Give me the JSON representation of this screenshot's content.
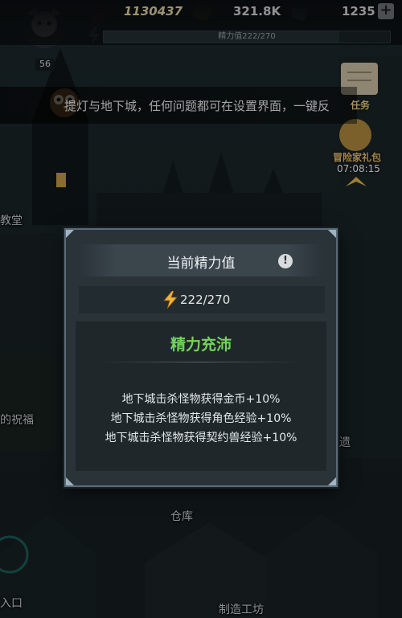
{
  "topbar": {
    "gold_amount": "1130437",
    "coin_amount": "321.8K",
    "gem_amount": "1235",
    "plus_label": "+",
    "energy_bar_text": "精力值222/270",
    "energy_fraction": 0.822,
    "player_level": "56"
  },
  "marquee": {
    "text": "提灯与地下城，任何问题都可在设置界面，一键反"
  },
  "side": {
    "quest_label": "任务",
    "pack_label": "冒险家礼包",
    "pack_timer": "07:08:15"
  },
  "scene": {
    "labels": [
      "教堂",
      "的祝福",
      "入口",
      "仓库",
      "制造工坊",
      "遗"
    ]
  },
  "dialog": {
    "title": "当前精力值",
    "info_icon": "!",
    "energy_value": "222/270",
    "status": "精力充沛",
    "bonuses": [
      "地下城击杀怪物获得金币+10%",
      "地下城击杀怪物获得角色经验+10%",
      "地下城击杀怪物获得契约兽经验+10%"
    ]
  },
  "colors": {
    "status_green": "#73d35a",
    "gold_text": "#e8d7a6",
    "energy_bolt": "#f0b23a"
  }
}
